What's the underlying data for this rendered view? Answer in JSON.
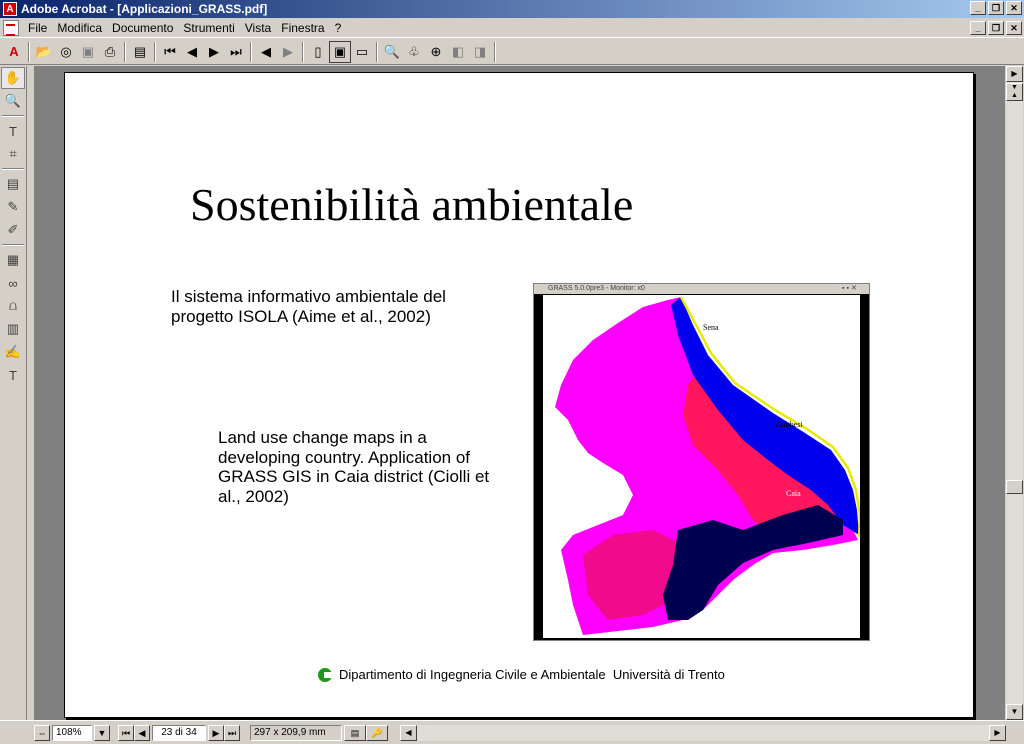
{
  "window": {
    "title": "Adobe Acrobat - [Applicazioni_GRASS.pdf]"
  },
  "menu": [
    "File",
    "Modifica",
    "Documento",
    "Strumenti",
    "Vista",
    "Finestra",
    "?"
  ],
  "toolbar": {
    "icons": [
      "acrobat-logo-icon",
      "open-icon",
      "open-web-icon",
      "save-icon",
      "print-icon",
      "show-navigation-icon",
      "first-page-icon",
      "previous-page-icon",
      "next-page-icon",
      "last-page-icon",
      "go-back-icon",
      "go-forward-icon",
      "actual-size-icon",
      "fit-page-icon",
      "fit-width-icon",
      "find-icon",
      "search-icon",
      "web-search-icon",
      "rotate-left-icon",
      "rotate-right-icon"
    ]
  },
  "document": {
    "title": "Sostenibilità ambientale",
    "paragraph1": "Il sistema informativo ambientale del progetto ISOLA (Aime et al., 2002)",
    "paragraph2": "Land use change maps in a developing country. Application of GRASS GIS in Caia district (Ciolli et al., 2002)",
    "map": {
      "window_title": "GRASS 5.0.0pre3 - Monitor: x0",
      "labels": {
        "sena": "Sena",
        "zambezi": "Zambesi",
        "caia": "Caia"
      },
      "colors": {
        "land": "#ff00ff",
        "urban": "#ff1a40",
        "river": "#0000ee",
        "water_dark": "#000050",
        "bank": "#e8e800"
      }
    },
    "footer": "Dipartimento di Ingegneria Civile e Ambientale  Università di Trento"
  },
  "statusbar": {
    "zoom": "108%",
    "page": "23 di 34",
    "size": "297 x 209,9 mm"
  }
}
